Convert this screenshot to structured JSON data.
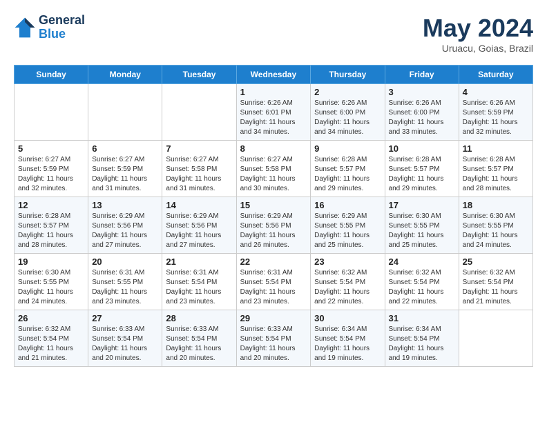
{
  "header": {
    "logo_line1": "General",
    "logo_line2": "Blue",
    "month": "May 2024",
    "location": "Uruacu, Goias, Brazil"
  },
  "weekdays": [
    "Sunday",
    "Monday",
    "Tuesday",
    "Wednesday",
    "Thursday",
    "Friday",
    "Saturday"
  ],
  "weeks": [
    [
      {
        "day": "",
        "sunrise": "",
        "sunset": "",
        "daylight": ""
      },
      {
        "day": "",
        "sunrise": "",
        "sunset": "",
        "daylight": ""
      },
      {
        "day": "",
        "sunrise": "",
        "sunset": "",
        "daylight": ""
      },
      {
        "day": "1",
        "sunrise": "Sunrise: 6:26 AM",
        "sunset": "Sunset: 6:01 PM",
        "daylight": "Daylight: 11 hours and 34 minutes."
      },
      {
        "day": "2",
        "sunrise": "Sunrise: 6:26 AM",
        "sunset": "Sunset: 6:00 PM",
        "daylight": "Daylight: 11 hours and 34 minutes."
      },
      {
        "day": "3",
        "sunrise": "Sunrise: 6:26 AM",
        "sunset": "Sunset: 6:00 PM",
        "daylight": "Daylight: 11 hours and 33 minutes."
      },
      {
        "day": "4",
        "sunrise": "Sunrise: 6:26 AM",
        "sunset": "Sunset: 5:59 PM",
        "daylight": "Daylight: 11 hours and 32 minutes."
      }
    ],
    [
      {
        "day": "5",
        "sunrise": "Sunrise: 6:27 AM",
        "sunset": "Sunset: 5:59 PM",
        "daylight": "Daylight: 11 hours and 32 minutes."
      },
      {
        "day": "6",
        "sunrise": "Sunrise: 6:27 AM",
        "sunset": "Sunset: 5:59 PM",
        "daylight": "Daylight: 11 hours and 31 minutes."
      },
      {
        "day": "7",
        "sunrise": "Sunrise: 6:27 AM",
        "sunset": "Sunset: 5:58 PM",
        "daylight": "Daylight: 11 hours and 31 minutes."
      },
      {
        "day": "8",
        "sunrise": "Sunrise: 6:27 AM",
        "sunset": "Sunset: 5:58 PM",
        "daylight": "Daylight: 11 hours and 30 minutes."
      },
      {
        "day": "9",
        "sunrise": "Sunrise: 6:28 AM",
        "sunset": "Sunset: 5:57 PM",
        "daylight": "Daylight: 11 hours and 29 minutes."
      },
      {
        "day": "10",
        "sunrise": "Sunrise: 6:28 AM",
        "sunset": "Sunset: 5:57 PM",
        "daylight": "Daylight: 11 hours and 29 minutes."
      },
      {
        "day": "11",
        "sunrise": "Sunrise: 6:28 AM",
        "sunset": "Sunset: 5:57 PM",
        "daylight": "Daylight: 11 hours and 28 minutes."
      }
    ],
    [
      {
        "day": "12",
        "sunrise": "Sunrise: 6:28 AM",
        "sunset": "Sunset: 5:57 PM",
        "daylight": "Daylight: 11 hours and 28 minutes."
      },
      {
        "day": "13",
        "sunrise": "Sunrise: 6:29 AM",
        "sunset": "Sunset: 5:56 PM",
        "daylight": "Daylight: 11 hours and 27 minutes."
      },
      {
        "day": "14",
        "sunrise": "Sunrise: 6:29 AM",
        "sunset": "Sunset: 5:56 PM",
        "daylight": "Daylight: 11 hours and 27 minutes."
      },
      {
        "day": "15",
        "sunrise": "Sunrise: 6:29 AM",
        "sunset": "Sunset: 5:56 PM",
        "daylight": "Daylight: 11 hours and 26 minutes."
      },
      {
        "day": "16",
        "sunrise": "Sunrise: 6:29 AM",
        "sunset": "Sunset: 5:55 PM",
        "daylight": "Daylight: 11 hours and 25 minutes."
      },
      {
        "day": "17",
        "sunrise": "Sunrise: 6:30 AM",
        "sunset": "Sunset: 5:55 PM",
        "daylight": "Daylight: 11 hours and 25 minutes."
      },
      {
        "day": "18",
        "sunrise": "Sunrise: 6:30 AM",
        "sunset": "Sunset: 5:55 PM",
        "daylight": "Daylight: 11 hours and 24 minutes."
      }
    ],
    [
      {
        "day": "19",
        "sunrise": "Sunrise: 6:30 AM",
        "sunset": "Sunset: 5:55 PM",
        "daylight": "Daylight: 11 hours and 24 minutes."
      },
      {
        "day": "20",
        "sunrise": "Sunrise: 6:31 AM",
        "sunset": "Sunset: 5:55 PM",
        "daylight": "Daylight: 11 hours and 23 minutes."
      },
      {
        "day": "21",
        "sunrise": "Sunrise: 6:31 AM",
        "sunset": "Sunset: 5:54 PM",
        "daylight": "Daylight: 11 hours and 23 minutes."
      },
      {
        "day": "22",
        "sunrise": "Sunrise: 6:31 AM",
        "sunset": "Sunset: 5:54 PM",
        "daylight": "Daylight: 11 hours and 23 minutes."
      },
      {
        "day": "23",
        "sunrise": "Sunrise: 6:32 AM",
        "sunset": "Sunset: 5:54 PM",
        "daylight": "Daylight: 11 hours and 22 minutes."
      },
      {
        "day": "24",
        "sunrise": "Sunrise: 6:32 AM",
        "sunset": "Sunset: 5:54 PM",
        "daylight": "Daylight: 11 hours and 22 minutes."
      },
      {
        "day": "25",
        "sunrise": "Sunrise: 6:32 AM",
        "sunset": "Sunset: 5:54 PM",
        "daylight": "Daylight: 11 hours and 21 minutes."
      }
    ],
    [
      {
        "day": "26",
        "sunrise": "Sunrise: 6:32 AM",
        "sunset": "Sunset: 5:54 PM",
        "daylight": "Daylight: 11 hours and 21 minutes."
      },
      {
        "day": "27",
        "sunrise": "Sunrise: 6:33 AM",
        "sunset": "Sunset: 5:54 PM",
        "daylight": "Daylight: 11 hours and 20 minutes."
      },
      {
        "day": "28",
        "sunrise": "Sunrise: 6:33 AM",
        "sunset": "Sunset: 5:54 PM",
        "daylight": "Daylight: 11 hours and 20 minutes."
      },
      {
        "day": "29",
        "sunrise": "Sunrise: 6:33 AM",
        "sunset": "Sunset: 5:54 PM",
        "daylight": "Daylight: 11 hours and 20 minutes."
      },
      {
        "day": "30",
        "sunrise": "Sunrise: 6:34 AM",
        "sunset": "Sunset: 5:54 PM",
        "daylight": "Daylight: 11 hours and 19 minutes."
      },
      {
        "day": "31",
        "sunrise": "Sunrise: 6:34 AM",
        "sunset": "Sunset: 5:54 PM",
        "daylight": "Daylight: 11 hours and 19 minutes."
      },
      {
        "day": "",
        "sunrise": "",
        "sunset": "",
        "daylight": ""
      }
    ]
  ]
}
